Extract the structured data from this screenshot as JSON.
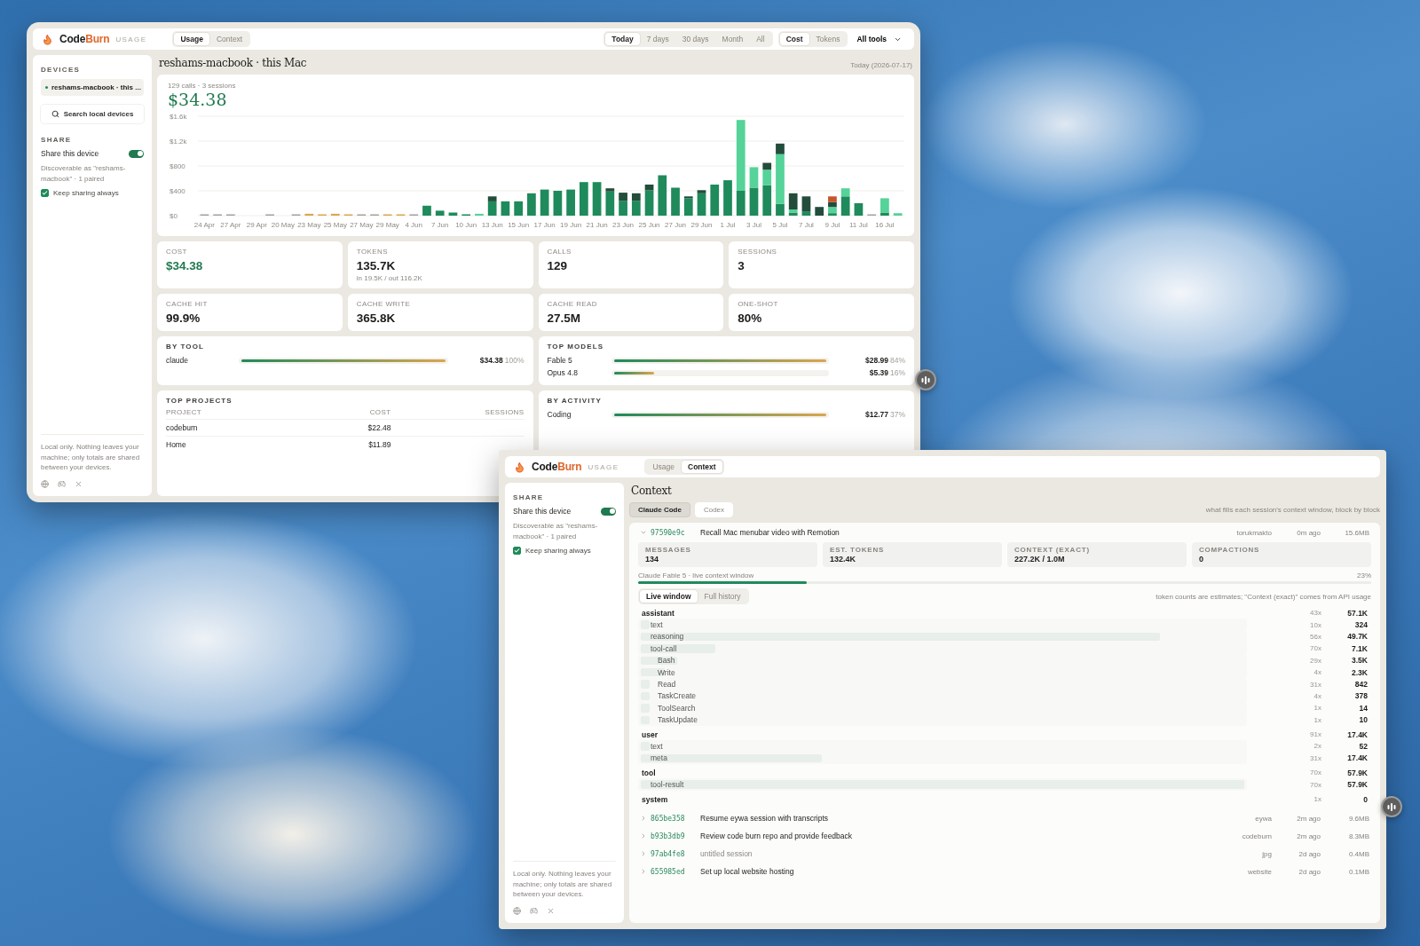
{
  "usage_window": {
    "brand": {
      "prefix": "Code",
      "accent": "Burn",
      "section": "USAGE"
    },
    "tabs": [
      {
        "label": "Usage",
        "selected": true
      },
      {
        "label": "Context",
        "selected": false
      }
    ],
    "ranges": [
      {
        "label": "Today",
        "selected": true
      },
      {
        "label": "7 days",
        "selected": false
      },
      {
        "label": "30 days",
        "selected": false
      },
      {
        "label": "Month",
        "selected": false
      },
      {
        "label": "All",
        "selected": false
      }
    ],
    "metric_toggle": [
      {
        "label": "Cost",
        "selected": true
      },
      {
        "label": "Tokens",
        "selected": false
      }
    ],
    "tool_filter": {
      "value": "All tools"
    },
    "sidebar": {
      "devices_heading": "DEVICES",
      "devices": [
        {
          "name": "reshams-macbook · this ...",
          "selected": true
        }
      ],
      "search_label": "Search local devices",
      "share_heading": "SHARE",
      "share_label": "Share this device",
      "share_on": true,
      "discoverable": "Discoverable as \"reshams-macbook\" · 1 paired",
      "keep_label": "Keep sharing always",
      "keep_checked": true,
      "footer": "Local only. Nothing leaves your machine; only totals are shared between your devices."
    },
    "title": "reshams-macbook · this Mac",
    "date": "Today (2026-07-17)",
    "summary": {
      "caption": "129 calls · 3 sessions",
      "total": "$34.38",
      "chart_data": {
        "type": "bar",
        "stacked": true,
        "grid": true,
        "categories": [
          "24 Apr",
          null,
          "27 Apr",
          null,
          "29 Apr",
          null,
          "20 May",
          null,
          "23 May",
          null,
          "25 May",
          null,
          "27 May",
          null,
          "29 May",
          null,
          "4 Jun",
          null,
          "7 Jun",
          null,
          "10 Jun",
          null,
          "13 Jun",
          null,
          "15 Jun",
          null,
          "17 Jun",
          null,
          "19 Jun",
          null,
          "21 Jun",
          null,
          "23 Jun",
          null,
          "25 Jun",
          null,
          "27 Jun",
          null,
          "29 Jun",
          null,
          "1 Jul",
          null,
          "3 Jul",
          null,
          "5 Jul",
          null,
          "7 Jul",
          null,
          "9 Jul",
          null,
          "11 Jul",
          null,
          "16 Jul",
          null
        ],
        "ylim": [
          0,
          1600
        ],
        "yticks": [
          {
            "value": 0,
            "label": "$0"
          },
          {
            "value": 400,
            "label": "$400"
          },
          {
            "value": 800,
            "label": "$800"
          },
          {
            "value": 1200,
            "label": "$1.2k"
          },
          {
            "value": 1600,
            "label": "$1.6k"
          }
        ],
        "series": [
          {
            "color": "#a3a29d",
            "values": [
              20,
              10,
              20,
              0,
              0,
              20,
              0,
              10,
              0,
              0,
              0,
              0,
              10,
              10,
              0,
              0,
              10,
              0,
              0,
              0,
              0,
              0,
              0,
              0,
              0,
              0,
              0,
              0,
              0,
              0,
              0,
              0,
              0,
              0,
              0,
              0,
              0,
              0,
              0,
              0,
              0,
              0,
              0,
              0,
              0,
              0,
              0,
              0,
              0,
              0,
              0,
              10,
              0,
              0
            ]
          },
          {
            "color": "#d9a650",
            "values": [
              0,
              0,
              0,
              0,
              0,
              0,
              0,
              0,
              30,
              10,
              30,
              20,
              0,
              0,
              20,
              20,
              0,
              0,
              0,
              0,
              0,
              0,
              0,
              0,
              0,
              0,
              0,
              0,
              0,
              0,
              0,
              0,
              0,
              0,
              0,
              0,
              0,
              0,
              0,
              0,
              0,
              0,
              0,
              0,
              0,
              0,
              0,
              0,
              0,
              0,
              0,
              0,
              0,
              0
            ]
          },
          {
            "color": "#1f8a5b",
            "values": [
              0,
              0,
              0,
              0,
              0,
              0,
              0,
              0,
              0,
              0,
              0,
              0,
              0,
              0,
              0,
              0,
              0,
              160,
              80,
              50,
              20,
              0,
              230,
              230,
              230,
              360,
              420,
              400,
              420,
              540,
              540,
              390,
              240,
              240,
              410,
              650,
              450,
              280,
              360,
              500,
              570,
              400,
              450,
              490,
              190,
              50,
              70,
              0,
              40,
              310,
              200,
              0,
              50,
              0
            ]
          },
          {
            "color": "#55d398",
            "values": [
              0,
              0,
              0,
              0,
              0,
              0,
              0,
              0,
              0,
              0,
              0,
              0,
              0,
              0,
              0,
              0,
              0,
              0,
              0,
              0,
              0,
              30,
              0,
              0,
              0,
              0,
              0,
              0,
              0,
              0,
              0,
              0,
              0,
              0,
              0,
              0,
              0,
              0,
              0,
              0,
              0,
              1140,
              330,
              250,
              800,
              50,
              0,
              0,
              100,
              130,
              0,
              0,
              230,
              40
            ]
          },
          {
            "color": "#234c3b",
            "values": [
              0,
              0,
              0,
              0,
              0,
              0,
              0,
              0,
              0,
              0,
              0,
              0,
              0,
              0,
              0,
              0,
              0,
              0,
              0,
              0,
              0,
              0,
              80,
              0,
              0,
              0,
              0,
              0,
              0,
              0,
              0,
              50,
              130,
              120,
              90,
              0,
              0,
              30,
              50,
              0,
              0,
              0,
              0,
              110,
              170,
              260,
              240,
              140,
              80,
              0,
              0,
              0,
              0,
              0
            ]
          },
          {
            "color": "#c8542a",
            "values": [
              0,
              0,
              0,
              0,
              0,
              0,
              0,
              0,
              0,
              0,
              0,
              0,
              0,
              0,
              0,
              0,
              0,
              0,
              0,
              0,
              0,
              0,
              0,
              0,
              0,
              0,
              0,
              0,
              0,
              0,
              0,
              0,
              0,
              0,
              0,
              0,
              0,
              0,
              0,
              0,
              0,
              0,
              0,
              0,
              0,
              0,
              0,
              0,
              90,
              0,
              0,
              0,
              0,
              0
            ]
          }
        ]
      }
    },
    "stats": [
      {
        "label": "COST",
        "value": "$34.38",
        "accent": true
      },
      {
        "label": "TOKENS",
        "value": "135.7K",
        "accent": false,
        "note": "in 19.5K / out 116.2K"
      },
      {
        "label": "CALLS",
        "value": "129",
        "accent": false
      },
      {
        "label": "SESSIONS",
        "value": "3",
        "accent": false
      },
      {
        "label": "CACHE HIT",
        "value": "99.9%",
        "accent": false
      },
      {
        "label": "CACHE WRITE",
        "value": "365.8K",
        "accent": false
      },
      {
        "label": "CACHE READ",
        "value": "27.5M",
        "accent": false
      },
      {
        "label": "ONE-SHOT",
        "value": "80%",
        "accent": false
      }
    ],
    "by_tool": {
      "heading": "BY TOOL",
      "rows": [
        {
          "name": "claude",
          "level": 1,
          "amount": "$34.38",
          "share": "100%"
        }
      ]
    },
    "top_models": {
      "heading": "TOP MODELS",
      "rows": [
        {
          "name": "Fable 5",
          "level": 1,
          "amount": "$28.99",
          "share": "84%"
        },
        {
          "name": "Opus 4.8",
          "level": 0.19,
          "amount": "$5.39",
          "share": "16%"
        }
      ]
    },
    "top_projects": {
      "heading": "TOP PROJECTS",
      "columns": [
        "PROJECT",
        "COST",
        "SESSIONS"
      ],
      "rows": [
        {
          "name": "codeburn",
          "cost": "$22.48"
        },
        {
          "name": "Home",
          "cost": "$11.89"
        }
      ]
    },
    "by_activity": {
      "heading": "BY ACTIVITY",
      "rows": [
        {
          "name": "Coding",
          "level": 1,
          "amount": "$12.77",
          "share": "37%"
        }
      ]
    }
  },
  "context_window": {
    "brand": {
      "prefix": "Code",
      "accent": "Burn",
      "section": "USAGE"
    },
    "tabs": [
      {
        "label": "Usage",
        "selected": false
      },
      {
        "label": "Context",
        "selected": true
      }
    ],
    "sidebar": {
      "share_heading": "SHARE",
      "share_label": "Share this device",
      "share_on": true,
      "discoverable": "Discoverable as \"reshams-macbook\" · 1 paired",
      "keep_label": "Keep sharing always",
      "keep_checked": true,
      "footer": "Local only. Nothing leaves your machine; only totals are shared between your devices."
    },
    "title": "Context",
    "sources": [
      {
        "label": "Claude Code",
        "selected": true
      },
      {
        "label": "Codex",
        "selected": false
      }
    ],
    "subtitle": "what fills each session's context window, block by block",
    "sessions": [
      {
        "id": "97590e9c",
        "title": "Recall Mac menubar video with Remotion",
        "project": "torukmakto",
        "age": "0m ago",
        "size": "15.6MB",
        "expanded": true,
        "muted": false,
        "detail": {
          "metrics": [
            {
              "label": "MESSAGES",
              "value": "134"
            },
            {
              "label": "EST. TOKENS",
              "value": "132.4K"
            },
            {
              "label": "CONTEXT (EXACT)",
              "value": "227.2K / 1.0M"
            },
            {
              "label": "COMPACTIONS",
              "value": "0"
            }
          ],
          "model_line": "Claude Fable 5 · live context window",
          "usage": "23%",
          "level": 0.23,
          "views": [
            {
              "label": "Live window",
              "selected": true
            },
            {
              "label": "Full history",
              "selected": false
            }
          ],
          "note": "token counts are estimates; \"Context (exact)\" comes from API usage",
          "blocks": [
            {
              "name": "assistant",
              "count": "43x",
              "tokens": "57.1K",
              "children": [
                {
                  "name": "text",
                  "count": "10x",
                  "tokens": "324",
                  "level": 0.006
                },
                {
                  "name": "reasoning",
                  "count": "56x",
                  "tokens": "49.7K",
                  "level": 0.86
                },
                {
                  "name": "tool-call",
                  "count": "70x",
                  "tokens": "7.1K",
                  "level": 0.123,
                  "children": [
                    {
                      "name": "Bash",
                      "count": "29x",
                      "tokens": "3.5K",
                      "level": 0.06
                    },
                    {
                      "name": "Write",
                      "count": "4x",
                      "tokens": "2.3K",
                      "level": 0.04
                    },
                    {
                      "name": "Read",
                      "count": "31x",
                      "tokens": "842",
                      "level": 0.015
                    },
                    {
                      "name": "TaskCreate",
                      "count": "4x",
                      "tokens": "378",
                      "level": 0.007
                    },
                    {
                      "name": "ToolSearch",
                      "count": "1x",
                      "tokens": "14",
                      "level": 0.001
                    },
                    {
                      "name": "TaskUpdate",
                      "count": "1x",
                      "tokens": "10",
                      "level": 0.001
                    }
                  ]
                }
              ]
            },
            {
              "name": "user",
              "count": "91x",
              "tokens": "17.4K",
              "children": [
                {
                  "name": "text",
                  "count": "2x",
                  "tokens": "52",
                  "level": 0.001
                },
                {
                  "name": "meta",
                  "count": "31x",
                  "tokens": "17.4K",
                  "level": 0.3
                }
              ]
            },
            {
              "name": "tool",
              "count": "70x",
              "tokens": "57.9K",
              "children": [
                {
                  "name": "tool-result",
                  "count": "70x",
                  "tokens": "57.9K",
                  "level": 1
                }
              ]
            },
            {
              "name": "system",
              "count": "1x",
              "tokens": "0"
            }
          ]
        }
      },
      {
        "id": "865be358",
        "title": "Resume eywa session with transcripts",
        "project": "eywa",
        "age": "2m ago",
        "size": "9.6MB",
        "expanded": false,
        "muted": false
      },
      {
        "id": "b93b3db9",
        "title": "Review code burn repo and provide feedback",
        "project": "codeburn",
        "age": "2m ago",
        "size": "8.3MB",
        "expanded": false,
        "muted": false
      },
      {
        "id": "97ab4fe8",
        "title": "untitled session",
        "project": "jpg",
        "age": "2d ago",
        "size": "0.4MB",
        "expanded": false,
        "muted": true
      },
      {
        "id": "655985ed",
        "title": "Set up local website hosting",
        "project": "website",
        "age": "2d ago",
        "size": "0.1MB",
        "expanded": false,
        "muted": false
      }
    ]
  }
}
